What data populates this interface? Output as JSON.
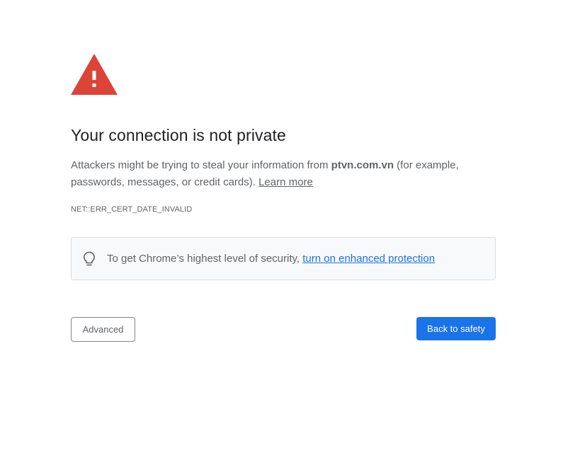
{
  "page": {
    "title": "Your connection is not private",
    "message_before": "Attackers might be trying to steal your information from ",
    "host": "ptvn.com.vn",
    "message_after": " (for example, passwords, messages, or credit cards). ",
    "learn_more": "Learn more",
    "error_code": "NET::ERR_CERT_DATE_INVALID"
  },
  "protection": {
    "text": "To get Chrome’s highest level of security, ",
    "link": "turn on enhanced protection",
    "icon": "lightbulb-icon"
  },
  "buttons": {
    "advanced": "Advanced",
    "back_to_safety": "Back to safety"
  },
  "icons": {
    "warning": "warning-triangle-icon"
  },
  "colors": {
    "warning_red": "#db4437",
    "primary_blue": "#1a73e8",
    "text_secondary": "#5f6368",
    "box_background": "#f8f9fa"
  }
}
